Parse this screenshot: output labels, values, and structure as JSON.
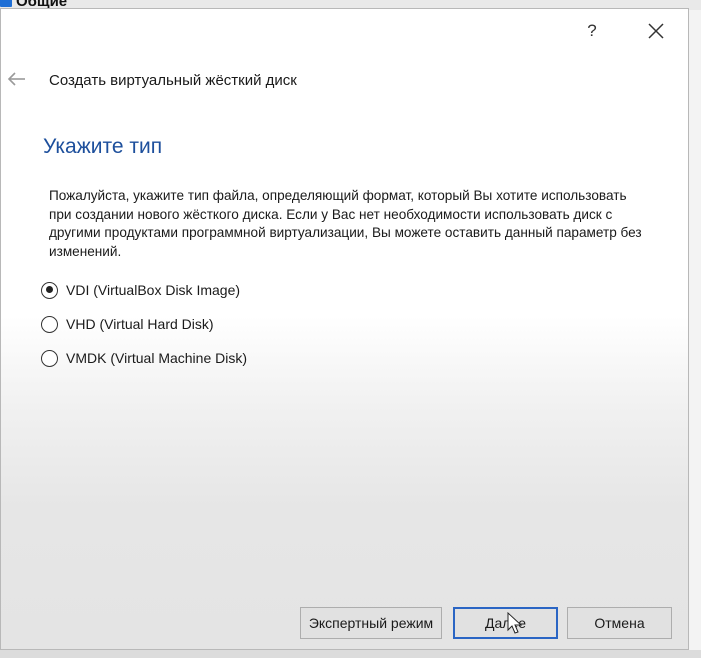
{
  "background": {
    "window_title": "Общие"
  },
  "dialog": {
    "help_label": "?",
    "wizard_title": "Создать виртуальный жёсткий диск",
    "page_heading": "Укажите тип",
    "description": "Пожалуйста, укажите тип файла, определяющий формат, который Вы хотите использовать при создании нового жёсткого диска. Если у Вас нет необходимости использовать диск с другими продуктами программной виртуализации, Вы можете оставить данный параметр без изменений.",
    "options": [
      {
        "label": "VDI (VirtualBox Disk Image)",
        "checked": true
      },
      {
        "label": "VHD (Virtual Hard Disk)",
        "checked": false
      },
      {
        "label": "VMDK (Virtual Machine Disk)",
        "checked": false
      }
    ],
    "buttons": {
      "expert": "Экспертный режим",
      "next": "Далее",
      "cancel": "Отмена"
    }
  },
  "colors": {
    "heading": "#1d4f9c",
    "default_button_border": "#2a65c4"
  }
}
